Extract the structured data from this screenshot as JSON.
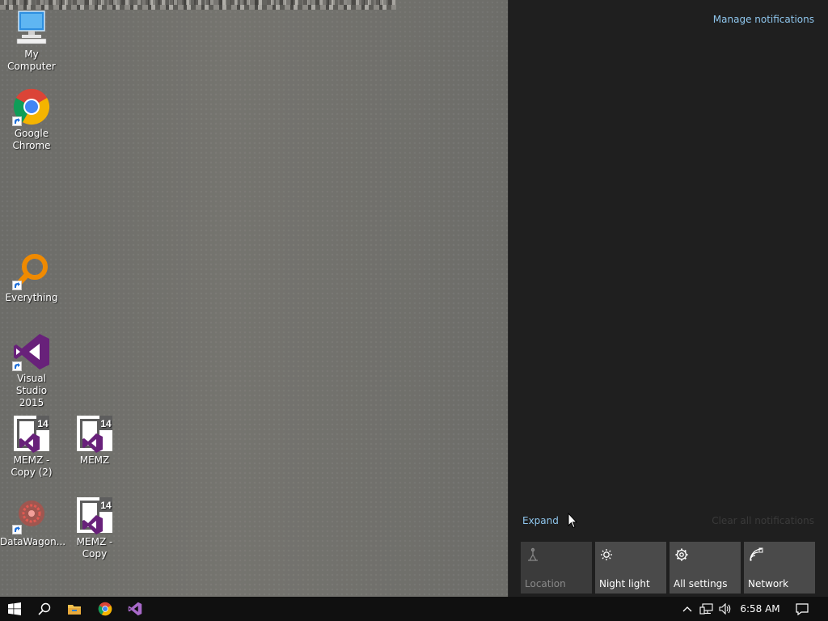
{
  "desktop": {
    "icons": [
      {
        "label": "My Computer"
      },
      {
        "label": "Google Chrome"
      },
      {
        "label": "Everything"
      },
      {
        "label": "Visual Studio 2015"
      },
      {
        "label": "MEMZ - Copy (2)"
      },
      {
        "label": "MEMZ"
      },
      {
        "label": "DataWagon..."
      },
      {
        "label": "MEMZ - Copy"
      }
    ]
  },
  "action_center": {
    "manage_label": "Manage notifications",
    "expand_label": "Expand",
    "clear_all_label": "Clear all notifications",
    "tiles": [
      {
        "label": "Location",
        "icon": "location-icon",
        "enabled": false
      },
      {
        "label": "Night light",
        "icon": "night-light-icon",
        "enabled": true
      },
      {
        "label": "All settings",
        "icon": "gear-icon",
        "enabled": true
      },
      {
        "label": "Network",
        "icon": "network-icon",
        "enabled": true
      }
    ]
  },
  "taskbar": {
    "pinned": [
      "start-icon",
      "search-icon",
      "file-explorer-icon",
      "chrome-icon",
      "visual-studio-icon"
    ],
    "clock": "6:58 AM"
  },
  "colors": {
    "accent_link": "#8ec5ec",
    "action_center_bg": "#1f1f1f",
    "tile_bg": "#4a4a4a",
    "taskbar_bg": "#101010"
  }
}
